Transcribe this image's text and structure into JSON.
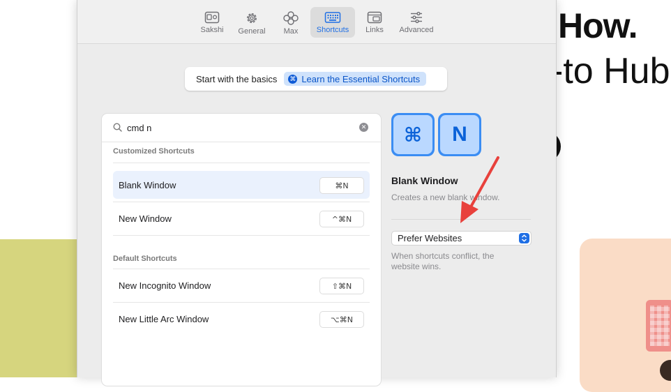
{
  "background_page": {
    "headline": "How.",
    "subheadline": "-to Hub"
  },
  "toolbar": {
    "tabs": [
      {
        "label": "Sakshi",
        "icon": "profile-card-icon",
        "active": false
      },
      {
        "label": "General",
        "icon": "gear-icon",
        "active": false
      },
      {
        "label": "Max",
        "icon": "sparkle-icon",
        "active": false
      },
      {
        "label": "Shortcuts",
        "icon": "keyboard-icon",
        "active": true
      },
      {
        "label": "Links",
        "icon": "window-stack-icon",
        "active": false
      },
      {
        "label": "Advanced",
        "icon": "sliders-icon",
        "active": false
      }
    ]
  },
  "basics": {
    "text": "Start with the basics",
    "button_label": "Learn the Essential Shortcuts",
    "button_glyph": "⌘"
  },
  "search": {
    "value": "cmd n",
    "placeholder": "Search",
    "clear_glyph": "✕"
  },
  "customized": {
    "heading": "Customized Shortcuts",
    "rows": [
      {
        "label": "Blank Window",
        "keys": "⌘N",
        "selected": true
      },
      {
        "label": "New Window",
        "keys": "^⌘N",
        "selected": false
      }
    ]
  },
  "default": {
    "heading": "Default Shortcuts",
    "rows": [
      {
        "label": "New Incognito Window",
        "keys": "⇧⌘N"
      },
      {
        "label": "New Little Arc Window",
        "keys": "⌥⌘N"
      }
    ]
  },
  "detail": {
    "keys": [
      "⌘",
      "N"
    ],
    "title": "Blank Window",
    "description": "Creates a new blank window.",
    "conflict_select": "Prefer Websites",
    "conflict_note": "When shortcuts conflict, the website wins."
  },
  "colors": {
    "accent": "#1f6fe5",
    "arrow": "#e8413c",
    "selected_row": "#eaf1fd"
  }
}
